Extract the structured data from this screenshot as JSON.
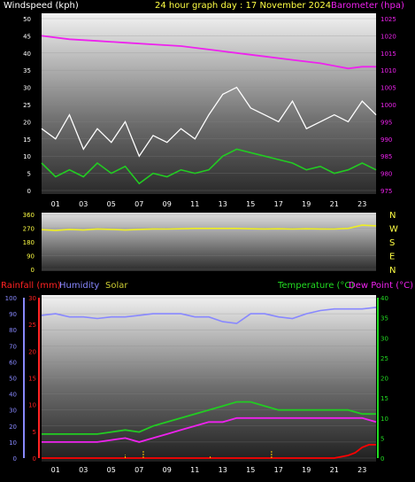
{
  "header": {
    "windspeed_label": "Windspeed (kph)",
    "title": "24 hour graph day : 17 November 2024",
    "barometer_label": "Barometer (hpa)"
  },
  "hour_labels": [
    "01",
    "03",
    "05",
    "07",
    "09",
    "11",
    "13",
    "15",
    "17",
    "19",
    "21",
    "23"
  ],
  "colors": {
    "wind_max": "#ffffff",
    "wind_avg": "#22cc22",
    "barometer": "#ee22ee",
    "direction": "#eeee22",
    "humidity": "#8888ff",
    "temperature": "#22cc22",
    "dewpoint": "#ee22ee",
    "rainfall": "#ff0000",
    "solar": "#ffcc00"
  },
  "chart_data": [
    {
      "type": "line",
      "title": "24 hour graph day : 17 November 2024",
      "left_axis": {
        "label": "Windspeed (kph)",
        "ticks": [
          0,
          5,
          10,
          15,
          20,
          25,
          30,
          35,
          40,
          45,
          50
        ],
        "range": [
          0,
          50
        ]
      },
      "right_axis": {
        "label": "Barometer (hpa)",
        "ticks": [
          975,
          980,
          985,
          990,
          995,
          1000,
          1005,
          1010,
          1015,
          1020,
          1025
        ],
        "range": [
          975,
          1025
        ]
      },
      "x_ticks": [
        "01",
        "03",
        "05",
        "07",
        "09",
        "11",
        "13",
        "15",
        "17",
        "19",
        "21",
        "23"
      ],
      "series": [
        {
          "axis": "right",
          "x": [
            0,
            2,
            4,
            6,
            8,
            10,
            12,
            14,
            16,
            18,
            20,
            22,
            23,
            24
          ],
          "values": [
            1020,
            1019,
            1018.5,
            1018,
            1017.5,
            1017,
            1016,
            1015,
            1014,
            1013,
            1012,
            1010.5,
            1011,
            1011
          ]
        },
        {
          "axis": "left",
          "x": [
            0,
            1,
            2,
            3,
            4,
            5,
            6,
            7,
            8,
            9,
            10,
            11,
            12,
            13,
            14,
            15,
            16,
            17,
            18,
            19,
            20,
            21,
            22,
            23,
            24
          ],
          "values": [
            8,
            4,
            6,
            4,
            8,
            5,
            7,
            2,
            5,
            4,
            6,
            5,
            6,
            10,
            12,
            11,
            10,
            9,
            8,
            6,
            7,
            5,
            6,
            8,
            6
          ]
        },
        {
          "axis": "left",
          "x": [
            0,
            1,
            2,
            3,
            4,
            5,
            6,
            7,
            8,
            9,
            10,
            11,
            12,
            13,
            14,
            15,
            16,
            17,
            18,
            19,
            20,
            21,
            22,
            23,
            24
          ],
          "values": [
            18,
            15,
            22,
            12,
            18,
            14,
            20,
            10,
            16,
            14,
            18,
            15,
            22,
            28,
            30,
            24,
            22,
            20,
            26,
            18,
            20,
            22,
            20,
            26,
            22
          ]
        }
      ]
    },
    {
      "type": "line",
      "left_axis": {
        "ticks": [
          0,
          90,
          180,
          270,
          360
        ],
        "range": [
          0,
          360
        ]
      },
      "right_axis": {
        "ticks": [
          "N",
          "W",
          "S",
          "E",
          "N"
        ]
      },
      "series": [
        {
          "x": [
            0,
            1,
            2,
            3,
            4,
            5,
            6,
            7,
            8,
            9,
            10,
            11,
            12,
            13,
            14,
            15,
            16,
            17,
            18,
            19,
            20,
            21,
            22,
            23,
            24
          ],
          "values": [
            260,
            255,
            262,
            258,
            265,
            262,
            258,
            262,
            265,
            264,
            266,
            268,
            268,
            268,
            268,
            266,
            265,
            266,
            264,
            266,
            265,
            264,
            268,
            290,
            285
          ]
        }
      ]
    },
    {
      "type": "line",
      "legend": [
        "Rainfall (mm)",
        "Humidity",
        "Solar",
        "Temperature (°C)",
        "Dew Point (°C)"
      ],
      "rain_axis": {
        "ticks": [
          0,
          5,
          10,
          15,
          20,
          25,
          30
        ],
        "range": [
          0,
          30
        ]
      },
      "humidity_axis": {
        "ticks": [
          0,
          10,
          20,
          30,
          40,
          50,
          60,
          70,
          80,
          90,
          100
        ],
        "range": [
          0,
          100
        ]
      },
      "temp_axis": {
        "ticks": [
          0,
          5,
          10,
          15,
          20,
          25,
          30,
          35,
          40
        ],
        "range": [
          0,
          40
        ]
      },
      "series": [
        {
          "name": "Humidity",
          "axis": "humidity",
          "x": [
            0,
            1,
            2,
            3,
            4,
            5,
            6,
            7,
            8,
            9,
            10,
            11,
            12,
            13,
            14,
            15,
            16,
            17,
            18,
            19,
            20,
            21,
            22,
            23,
            24
          ],
          "values": [
            89,
            90,
            88,
            88,
            87,
            88,
            88,
            89,
            90,
            90,
            90,
            88,
            88,
            85,
            84,
            90,
            90,
            88,
            87,
            90,
            92,
            93,
            93,
            93,
            94
          ]
        },
        {
          "name": "Temperature (°C)",
          "axis": "temp",
          "x": [
            0,
            1,
            2,
            3,
            4,
            5,
            6,
            7,
            8,
            9,
            10,
            11,
            12,
            13,
            14,
            15,
            16,
            17,
            18,
            19,
            20,
            21,
            22,
            23,
            24
          ],
          "values": [
            6,
            6,
            6,
            6,
            6,
            6.5,
            7,
            6.5,
            8,
            9,
            10,
            11,
            12,
            13,
            14,
            14,
            13,
            12,
            12,
            12,
            12,
            12,
            12,
            11,
            11
          ]
        },
        {
          "name": "Dew Point (°C)",
          "axis": "temp",
          "x": [
            0,
            1,
            2,
            3,
            4,
            5,
            6,
            7,
            8,
            9,
            10,
            11,
            12,
            13,
            14,
            15,
            16,
            17,
            18,
            19,
            20,
            21,
            22,
            23,
            24
          ],
          "values": [
            4,
            4,
            4,
            4,
            4,
            4.5,
            5,
            4,
            5,
            6,
            7,
            8,
            9,
            9,
            10,
            10,
            10,
            10,
            10,
            10,
            10,
            10,
            10,
            10,
            9
          ]
        },
        {
          "name": "Rainfall (mm)",
          "axis": "rain",
          "x": [
            0,
            1,
            2,
            3,
            4,
            5,
            6,
            7,
            8,
            9,
            10,
            11,
            12,
            13,
            14,
            15,
            16,
            17,
            18,
            19,
            20,
            21,
            22,
            22.5,
            23,
            23.5,
            24
          ],
          "values": [
            0,
            0,
            0,
            0,
            0,
            0,
            0,
            0,
            0,
            0,
            0,
            0,
            0,
            0,
            0,
            0,
            0,
            0,
            0,
            0,
            0,
            0,
            0.5,
            1,
            2,
            2.5,
            2.5
          ]
        },
        {
          "name": "Solar",
          "axis": "humidity",
          "x": [
            6.0,
            7.3,
            12.1,
            16.5
          ],
          "values": [
            2,
            5,
            1,
            5
          ]
        }
      ]
    }
  ]
}
